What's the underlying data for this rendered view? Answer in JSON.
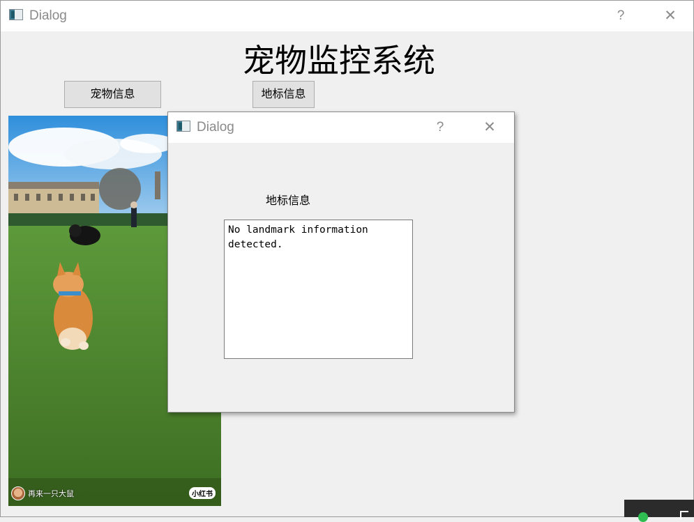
{
  "main_window": {
    "title": "Dialog",
    "help_glyph": "?",
    "close_glyph": "✕",
    "heading": "宠物监控系统",
    "buttons": {
      "pet_info": "宠物信息",
      "landmark_info": "地标信息"
    },
    "photo": {
      "caption": "再来一只大鼠",
      "badge": "小红书"
    }
  },
  "dialog": {
    "title": "Dialog",
    "help_glyph": "?",
    "close_glyph": "✕",
    "label": "地标信息",
    "text": "No landmark information\ndetected."
  }
}
